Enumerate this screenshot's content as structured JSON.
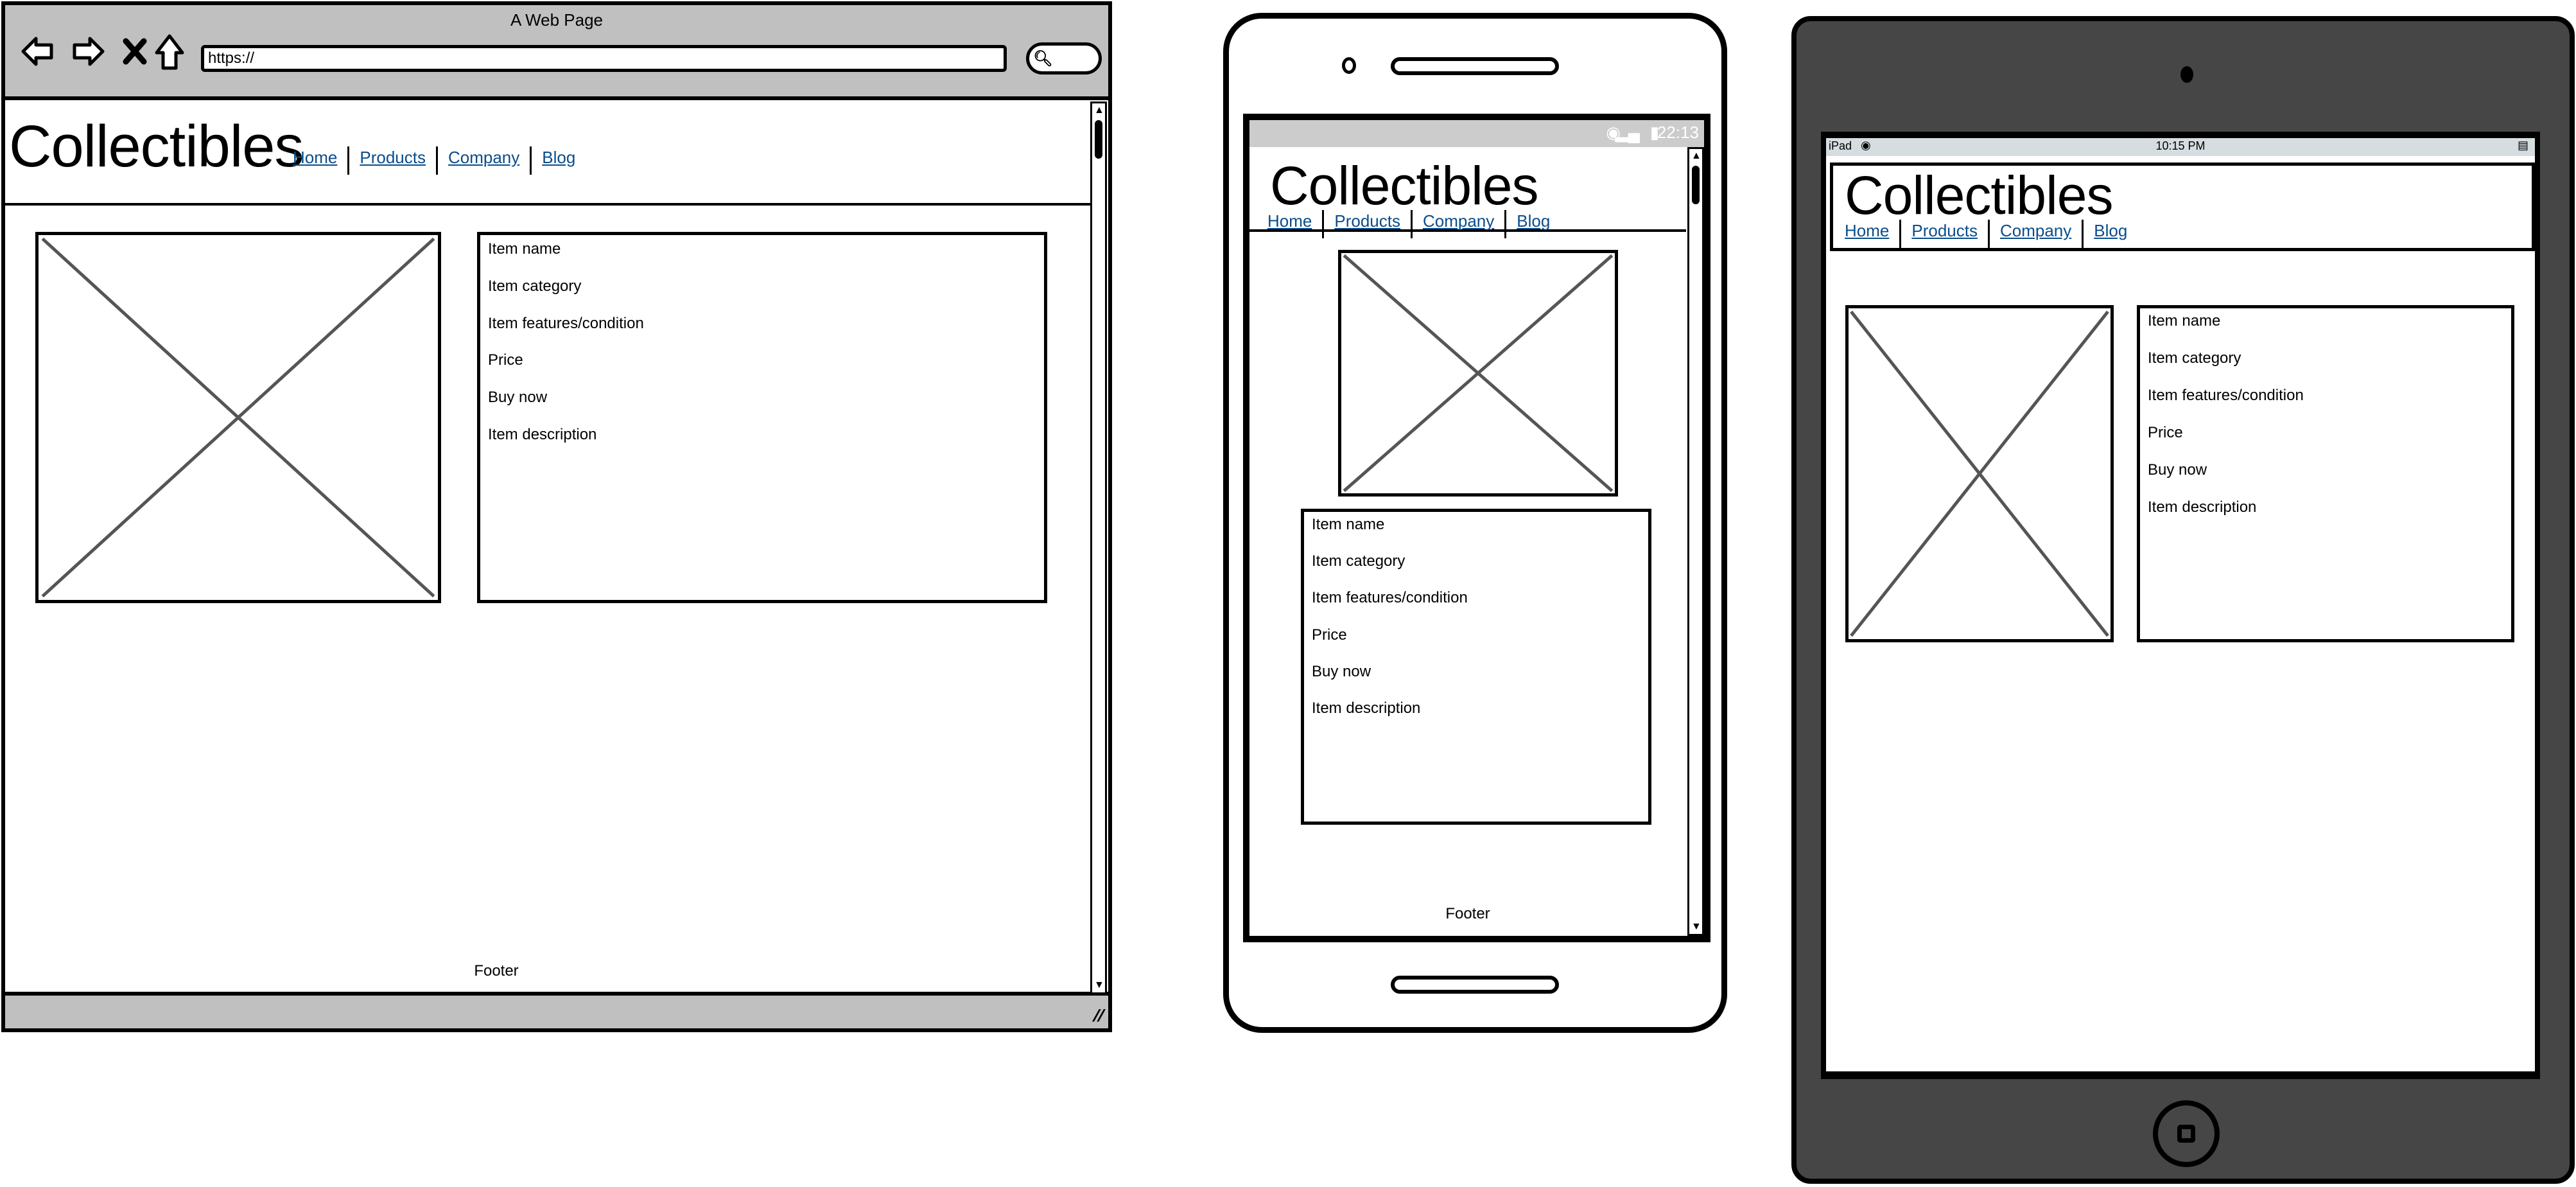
{
  "site": {
    "title": "Collectibles",
    "nav": [
      "Home",
      "Products",
      "Company",
      "Blog"
    ],
    "item_fields": [
      "Item name",
      "Item category",
      "Item features/condition",
      "Price",
      "Buy now",
      "Item description"
    ],
    "footer": "Footer",
    "image_placeholder": "image-placeholder",
    "link_color": "#0a4d8c"
  },
  "browser": {
    "window_title": "A Web Page",
    "url": "https://",
    "icons": [
      "back-arrow-icon",
      "forward-arrow-icon",
      "stop-icon",
      "home-icon",
      "search-icon",
      "resize-grip-icon"
    ],
    "chrome_color": "#c0c0c0"
  },
  "phone": {
    "status_time": "22:13",
    "status_icons": [
      "wifi-icon",
      "signal-icon",
      "battery-icon"
    ]
  },
  "tablet": {
    "device_label": "iPad",
    "status_time": "10:15 PM",
    "status_icons": [
      "wifi-icon",
      "battery-icon"
    ],
    "bezel_color": "#464646"
  }
}
